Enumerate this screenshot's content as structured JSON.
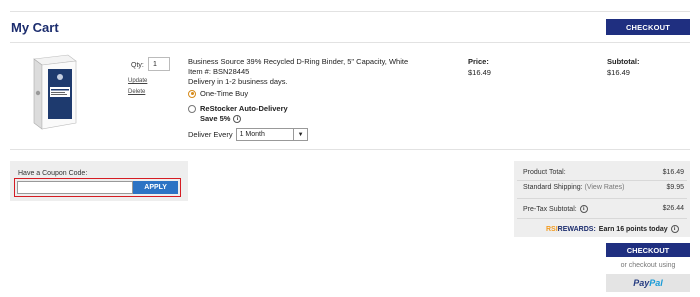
{
  "cart": {
    "title": "My Cart",
    "checkout_label": "CHECKOUT"
  },
  "item": {
    "qty_label": "Qty:",
    "qty_value": "1",
    "update_label": "Update",
    "delete_label": "Delete",
    "name": "Business Source 39% Recycled D-Ring Binder, 5\" Capacity, White",
    "item_number": "Item #: BSN28445",
    "delivery": "Delivery in 1-2 business days.",
    "option_one_time": "One-Time Buy",
    "option_restocker": "ReStocker Auto-Delivery",
    "restocker_save": "Save 5%",
    "deliver_every_label": "Deliver Every",
    "deliver_every_value": "1 Month",
    "price_label": "Price:",
    "price_value": "$16.49",
    "subtotal_label": "Subtotal:",
    "subtotal_value": "$16.49"
  },
  "coupon": {
    "label": "Have a Coupon Code:",
    "input_value": "",
    "apply_label": "APPLY"
  },
  "summary": {
    "product_total_label": "Product Total:",
    "product_total_value": "$16.49",
    "shipping_label": "Standard Shipping:",
    "shipping_rates_link": "(View Rates)",
    "shipping_value": "$9.95",
    "pretax_label": "Pre-Tax Subtotal:",
    "pretax_value": "$26.44",
    "rewards_rsi": "RSI",
    "rewards_brand": "REWARDS:",
    "rewards_text": "Earn 16 points today"
  },
  "bottom": {
    "checkout_label": "CHECKOUT",
    "or_text": "or checkout using",
    "paypal_part1": "Pay",
    "paypal_part2": "Pal"
  },
  "colors": {
    "navy": "#1f2f80",
    "apply_blue": "#2c73c4",
    "highlight_red": "#d51c23",
    "rsi_orange": "#f29a1e"
  }
}
